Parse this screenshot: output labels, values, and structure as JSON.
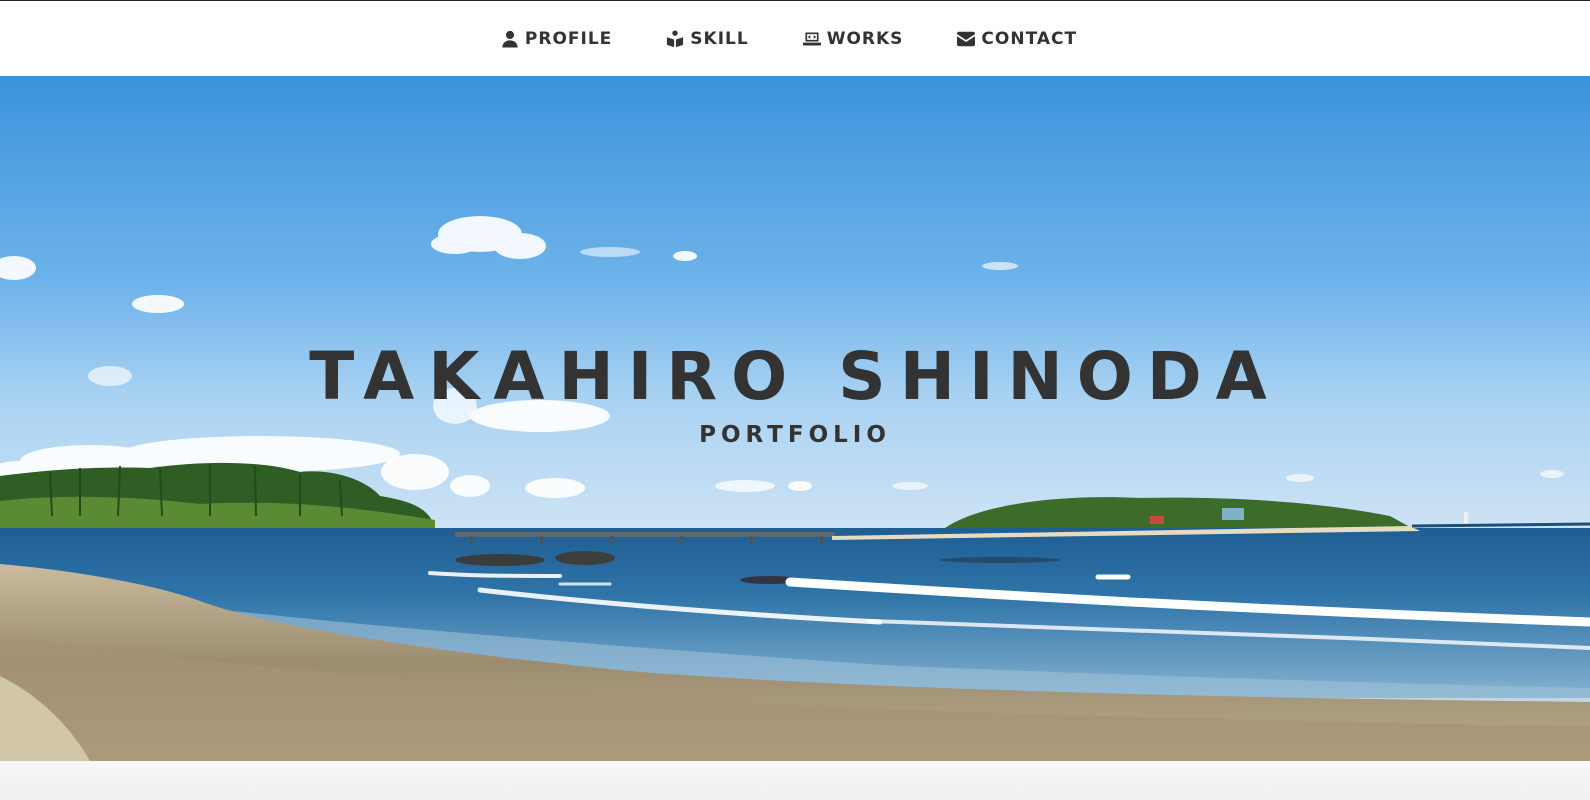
{
  "nav": {
    "items": [
      {
        "label": "PROFILE",
        "icon": "user-icon"
      },
      {
        "label": "SKILL",
        "icon": "book-reader-icon"
      },
      {
        "label": "WORKS",
        "icon": "laptop-code-icon"
      },
      {
        "label": "CONTACT",
        "icon": "envelope-icon"
      }
    ]
  },
  "hero": {
    "title": "TAKAHIRO SHINODA",
    "subtitle": "PORTFOLIO",
    "image": "beach-island-ocean-photo"
  },
  "colors": {
    "text": "#333333",
    "navbar_bg": "#ffffff",
    "sky_top": "#3f97de",
    "sea": "#2f6f9f",
    "sand": "#b9aa8d"
  }
}
